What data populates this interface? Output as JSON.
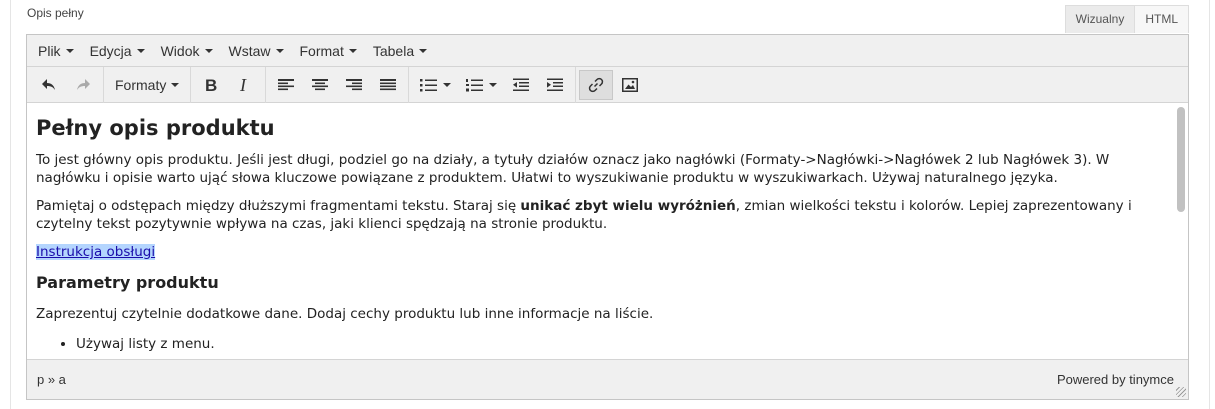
{
  "field": {
    "label": "Opis pełny"
  },
  "mode_tabs": [
    {
      "label": "Wizualny",
      "active": true
    },
    {
      "label": "HTML",
      "active": false
    }
  ],
  "menubar": [
    "Plik",
    "Edycja",
    "Widok",
    "Wstaw",
    "Format",
    "Tabela"
  ],
  "toolbar": {
    "formats_label": "Formaty",
    "buttons": [
      "undo-icon",
      "redo-icon",
      "bold-icon",
      "italic-icon",
      "align-left-icon",
      "align-center-icon",
      "align-right-icon",
      "align-justify-icon",
      "bullet-list-icon",
      "numbered-list-icon",
      "outdent-icon",
      "indent-icon",
      "link-icon",
      "image-icon"
    ]
  },
  "content": {
    "title": "Pełny opis produktu",
    "p1": "To jest główny opis produktu. Jeśli jest długi, podziel go na działy, a tytuły działów oznacz jako nagłówki (Formaty->Nagłówki->Nagłówek 2 lub Nagłówek 3). W nagłówku i opisie warto ująć słowa kluczowe powiązane z produktem. Ułatwi to wyszukiwanie produktu w wyszukiwarkach. Używaj naturalnego języka.",
    "p2_before": "Pamiętaj o odstępach między dłuższymi fragmentami tekstu. Staraj się ",
    "p2_bold": "unikać zbyt wielu wyróżnień",
    "p2_after": ", zmian wielkości tekstu i kolorów. Lepiej zaprezentowany i czytelny tekst pozytywnie wpływa na czas, jaki klienci spędzają na stronie produktu.",
    "link": "Instrukcja obsługi",
    "subtitle": "Parametry produktu",
    "p3": "Zaprezentuj czytelnie dodatkowe dane. Dodaj cechy produktu lub inne informacje na liście.",
    "list": [
      "Używaj listy z menu."
    ]
  },
  "statusbar": {
    "path": "p » a",
    "powered": "Powered by tinymce"
  }
}
